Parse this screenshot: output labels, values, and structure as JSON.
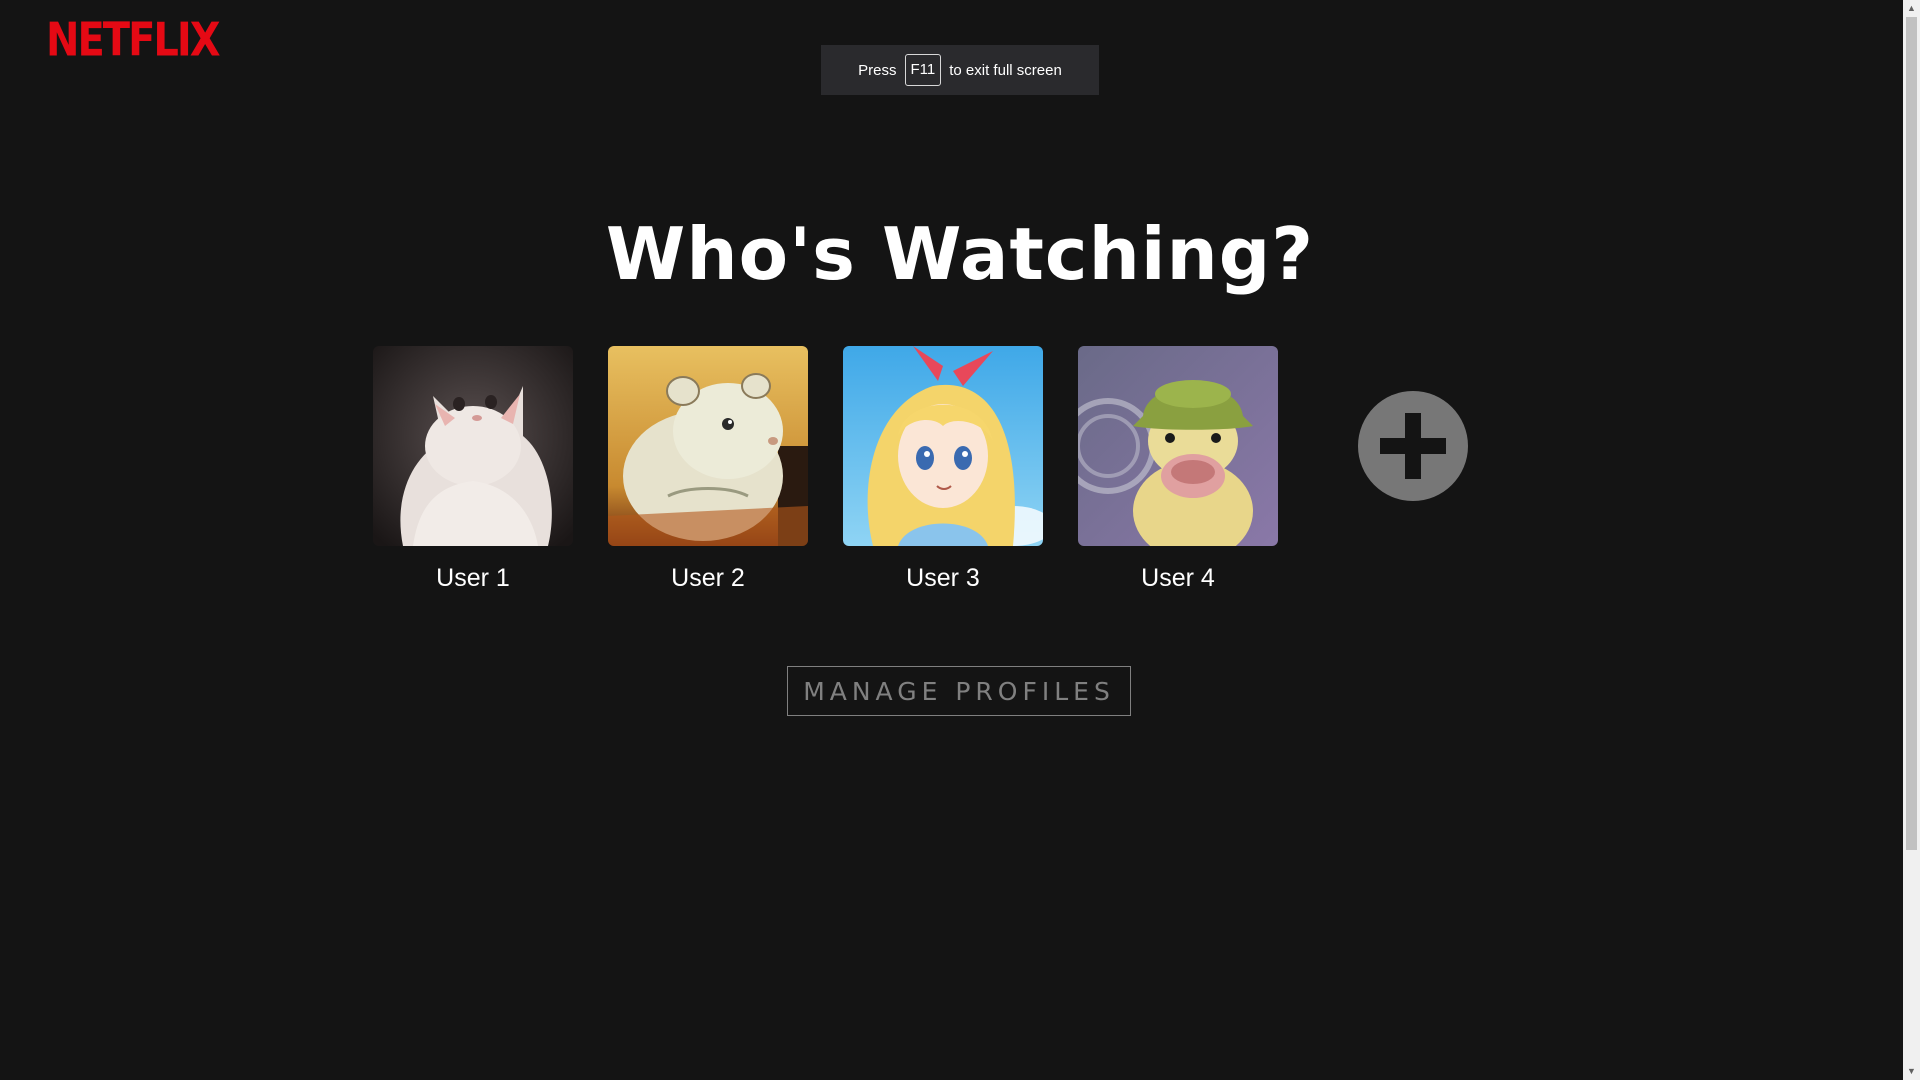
{
  "brand": {
    "logo_text": "NETFLIX",
    "color": "#e50914"
  },
  "fullscreen_toast": {
    "prefix": "Press",
    "key": "F11",
    "suffix": "to exit full screen"
  },
  "heading": "Who's Watching?",
  "profiles": [
    {
      "name": "User 1",
      "avatar": "white-cat-icon"
    },
    {
      "name": "User 2",
      "avatar": "hamster-cartoon-icon"
    },
    {
      "name": "User 3",
      "avatar": "anime-girl-icon"
    },
    {
      "name": "User 4",
      "avatar": "duckling-with-hat-icon"
    }
  ],
  "add_profile": {
    "icon": "plus-icon"
  },
  "manage_button": "MANAGE PROFILES",
  "colors": {
    "background": "#141414",
    "text": "#ffffff",
    "muted": "#808080"
  }
}
